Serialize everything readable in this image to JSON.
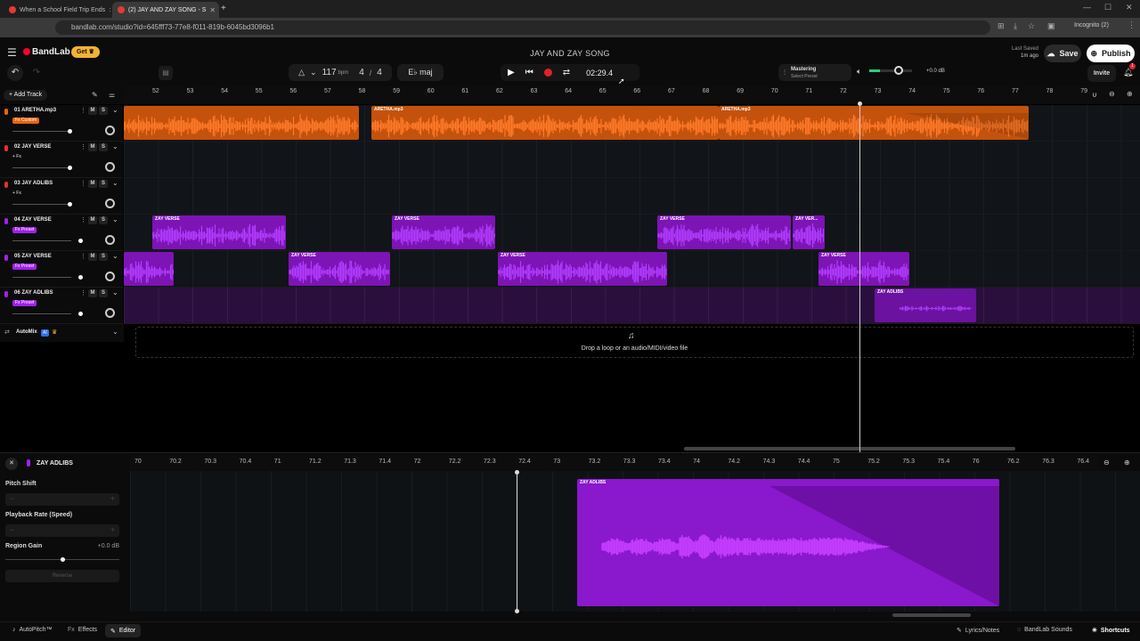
{
  "browser": {
    "tabs": [
      {
        "title": "When a School Field Trip Ends",
        "favicon_color": "#e53935",
        "active": false
      },
      {
        "title": "(2) JAY AND ZAY SONG - S",
        "favicon_color": "#e53935",
        "active": true
      }
    ],
    "url": "bandlab.com/studio?id=645fff73-77e8-f011-819b-6045bd3096b1",
    "profile": "Incognito (2)"
  },
  "header": {
    "logo": "BandLab",
    "get_label": "Get",
    "song_title": "JAY AND ZAY SONG",
    "last_saved_label": "Last Saved",
    "last_saved_value": "1m ago",
    "save_label": "Save",
    "publish_label": "Publish",
    "invite_label": "Invite",
    "notification_count": "1"
  },
  "toolbar": {
    "bpm": "117",
    "bpm_unit": "bpm",
    "time_sig_num": "4",
    "time_sig_sep": "/",
    "time_sig_den": "4",
    "key": "E♭ maj",
    "time": "02:29.4",
    "mastering_label": "Mastering",
    "mastering_preset": "Select Preset",
    "master_volume": "+0.0 dB",
    "add_track_label": "Add Track"
  },
  "ruler": [
    "52",
    "53",
    "54",
    "55",
    "56",
    "57",
    "58",
    "59",
    "60",
    "61",
    "62",
    "63",
    "64",
    "65",
    "66",
    "67",
    "68",
    "69",
    "70",
    "71",
    "72",
    "73",
    "74",
    "75",
    "76",
    "77",
    "78",
    "79"
  ],
  "tracks": [
    {
      "name": "01  ARETHA.mp3",
      "tag": "Fx Custom",
      "tag_color": "#e8650e",
      "color": "#e8650e"
    },
    {
      "name": "02  JAY VERSE",
      "tag": "+ Fx",
      "tag_color": "",
      "color": "#d33"
    },
    {
      "name": "03  JAY ADLIBS",
      "tag": "+ Fx",
      "tag_color": "",
      "color": "#d33"
    },
    {
      "name": "04  ZAY VERSE",
      "tag": "Fx Preset",
      "tag_color": "#a020f0",
      "color": "#a020f0"
    },
    {
      "name": "05  ZAY VERSE",
      "tag": "Fx Preset",
      "tag_color": "#a020f0",
      "color": "#a020f0"
    },
    {
      "name": "06  ZAY ADLIBS",
      "tag": "Fx Preset",
      "tag_color": "#a020f0",
      "color": "#a020f0"
    }
  ],
  "track_controls": {
    "mute": "M",
    "solo": "S"
  },
  "regions": {
    "aretha": [
      "ARETHA.mp3",
      "ARETHA.mp3"
    ],
    "zay_verse": "ZAY VERSE",
    "zay_verse_short": "ZAY VER...",
    "zay_adlibs": "ZAY ADLIBS"
  },
  "automix": {
    "label": "AutoMix",
    "badge": "AI"
  },
  "dropzone": "Drop a loop or an audio/MIDI/video file",
  "editor": {
    "track_name": "ZAY ADLIBS",
    "pitch_shift_label": "Pitch Shift",
    "playback_rate_label": "Playback Rate (Speed)",
    "region_gain_label": "Region Gain",
    "region_gain_value": "+0.0 dB",
    "reverse_label": "Reverse",
    "region_label": "ZAY ADLIBS",
    "ruler": [
      "70",
      "70.2",
      "70.3",
      "70.4",
      "71",
      "71.2",
      "71.3",
      "71.4",
      "72",
      "72.2",
      "72.3",
      "72.4",
      "73",
      "73.2",
      "73.3",
      "73.4",
      "74",
      "74.2",
      "74.3",
      "74.4",
      "75",
      "75.2",
      "75.3",
      "75.4",
      "76",
      "76.2",
      "76.3",
      "76.4"
    ]
  },
  "footer": {
    "autopitch": "AutoPitch™",
    "effects": "Effects",
    "editor": "Editor",
    "lyrics": "Lyrics/Notes",
    "sounds": "BandLab Sounds",
    "shortcuts": "Shortcuts"
  },
  "colors": {
    "orange": "#e8650e",
    "purple": "#a020f0",
    "accent": "#ff4b2b"
  }
}
